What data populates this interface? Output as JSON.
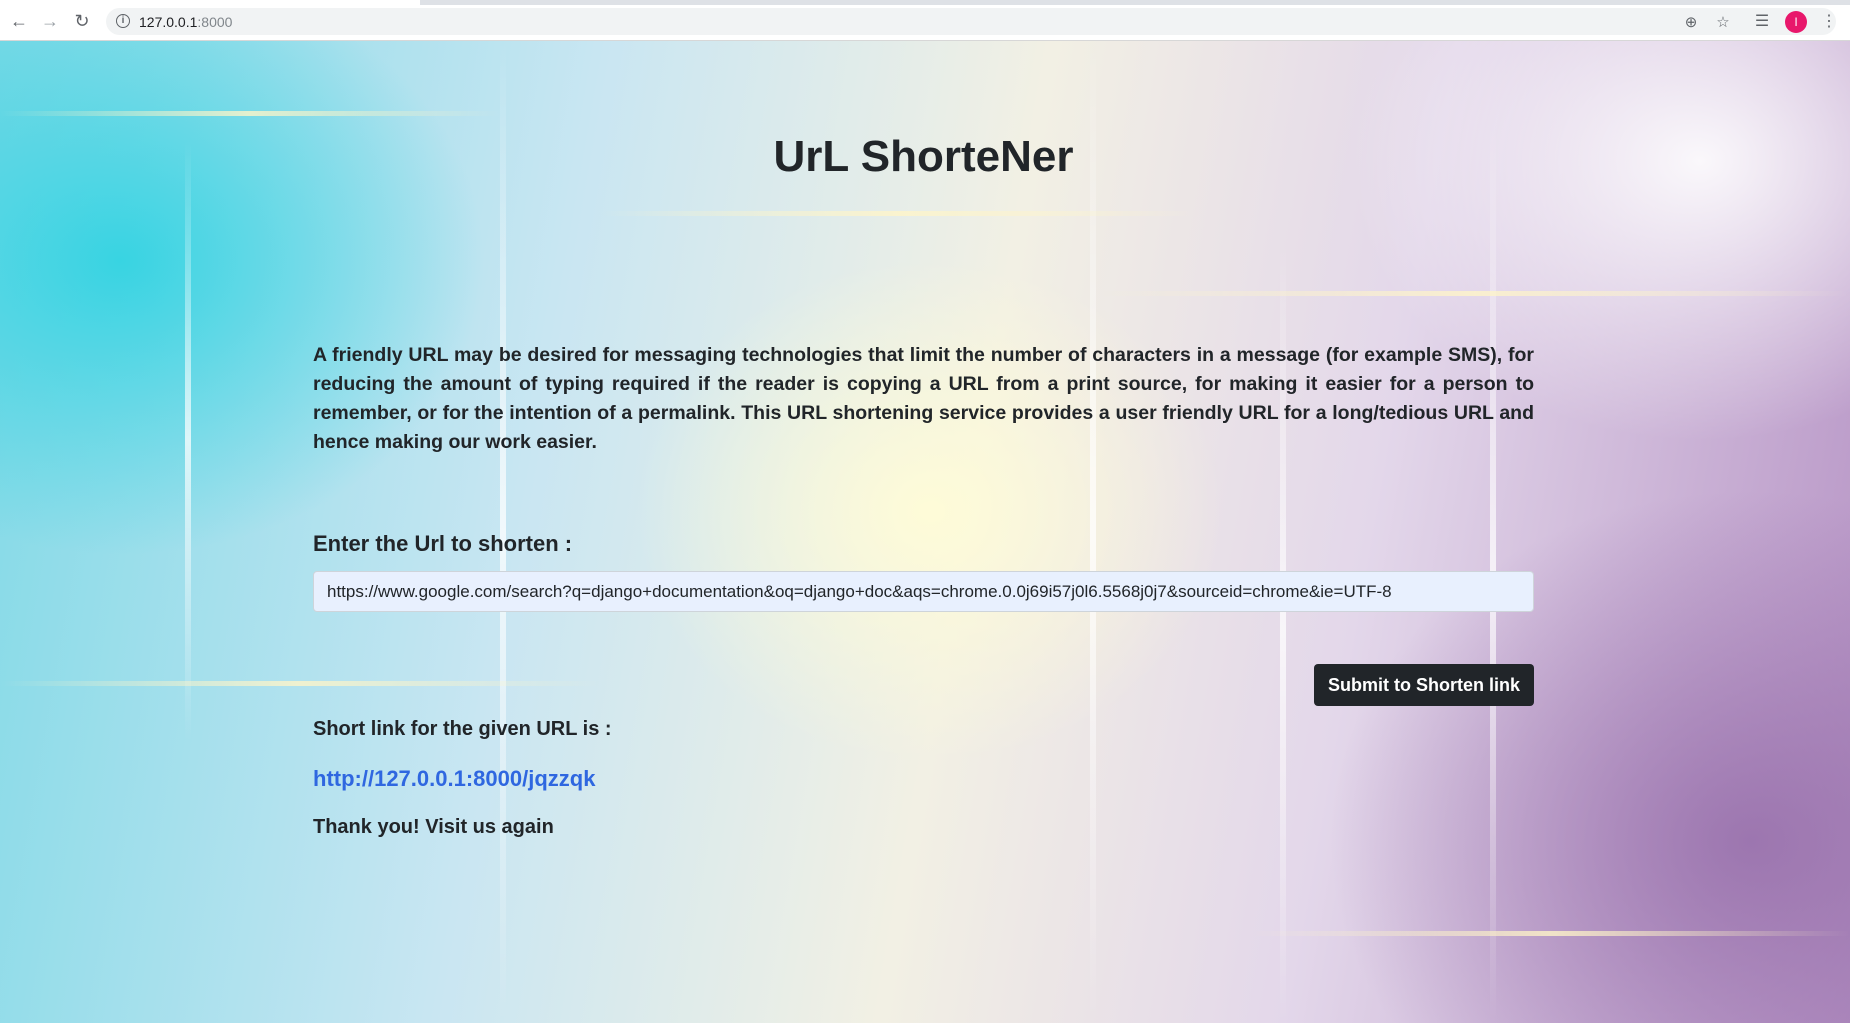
{
  "browser": {
    "url_host": "127.0.0.1",
    "url_port": ":8000",
    "avatar_initial": "I"
  },
  "header": {
    "title": "UrL ShorteNer"
  },
  "main": {
    "description": "A friendly URL may be desired for messaging technologies that limit the number of characters in a message (for example SMS), for reducing the amount of typing required if the reader is copying a URL from a print source, for making it easier for a person to remember, or for the intention of a permalink. This URL shortening service provides a user friendly URL for a long/tedious URL and hence making our work easier.",
    "input_label": "Enter the Url to shorten :",
    "input_value": "https://www.google.com/search?q=django+documentation&oq=django+doc&aqs=chrome.0.0j69i57j0l6.5568j0j7&sourceid=chrome&ie=UTF-8",
    "submit_label": "Submit to Shorten link",
    "result_label": "Short link for the given URL is :",
    "short_link": "http://127.0.0.1:8000/jqzzqk",
    "thanks": "Thank you! Visit us again"
  },
  "colors": {
    "link": "#2f67e0",
    "button_bg": "#212529",
    "avatar_bg": "#e8176b"
  }
}
